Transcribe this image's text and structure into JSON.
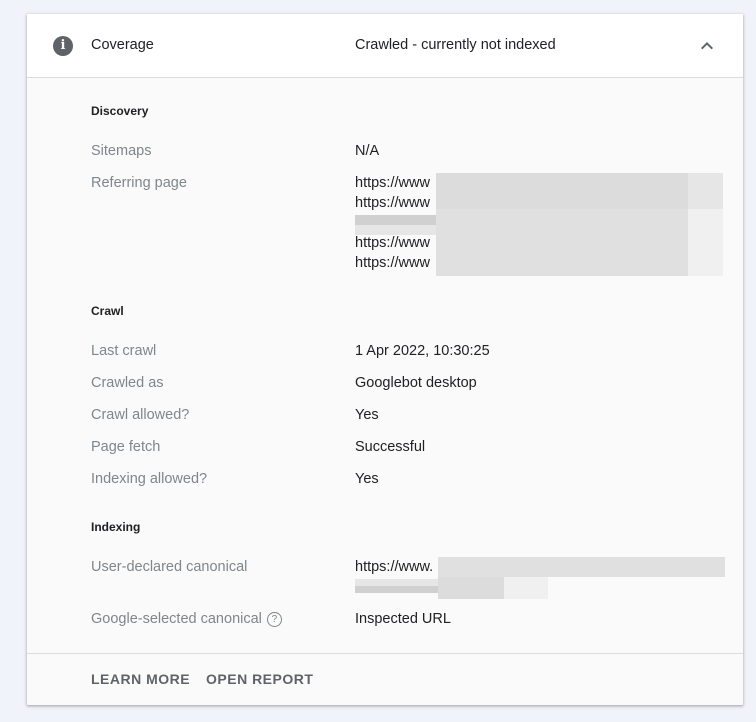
{
  "header": {
    "icon": "info-icon",
    "title": "Coverage",
    "status": "Crawled - currently not indexed",
    "collapse_icon": "chevron-up-icon"
  },
  "sections": [
    {
      "title": "Discovery",
      "rows": [
        {
          "label": "Sitemaps",
          "value": "N/A"
        },
        {
          "label": "Referring page",
          "values": [
            "https://www",
            "https://www",
            "",
            "https://www",
            "https://www"
          ],
          "redacted": true
        }
      ]
    },
    {
      "title": "Crawl",
      "rows": [
        {
          "label": "Last crawl",
          "value": "1 Apr 2022, 10:30:25"
        },
        {
          "label": "Crawled as",
          "value": "Googlebot desktop"
        },
        {
          "label": "Crawl allowed?",
          "value": "Yes"
        },
        {
          "label": "Page fetch",
          "value": "Successful"
        },
        {
          "label": "Indexing allowed?",
          "value": "Yes"
        }
      ]
    },
    {
      "title": "Indexing",
      "rows": [
        {
          "label": "User-declared canonical",
          "values": [
            "https://www."
          ],
          "redacted": true
        },
        {
          "label": "Google-selected canonical",
          "value": "Inspected URL",
          "help_icon": "?"
        }
      ]
    }
  ],
  "footer": {
    "learn_more": "LEARN MORE",
    "open_report": "OPEN REPORT"
  }
}
